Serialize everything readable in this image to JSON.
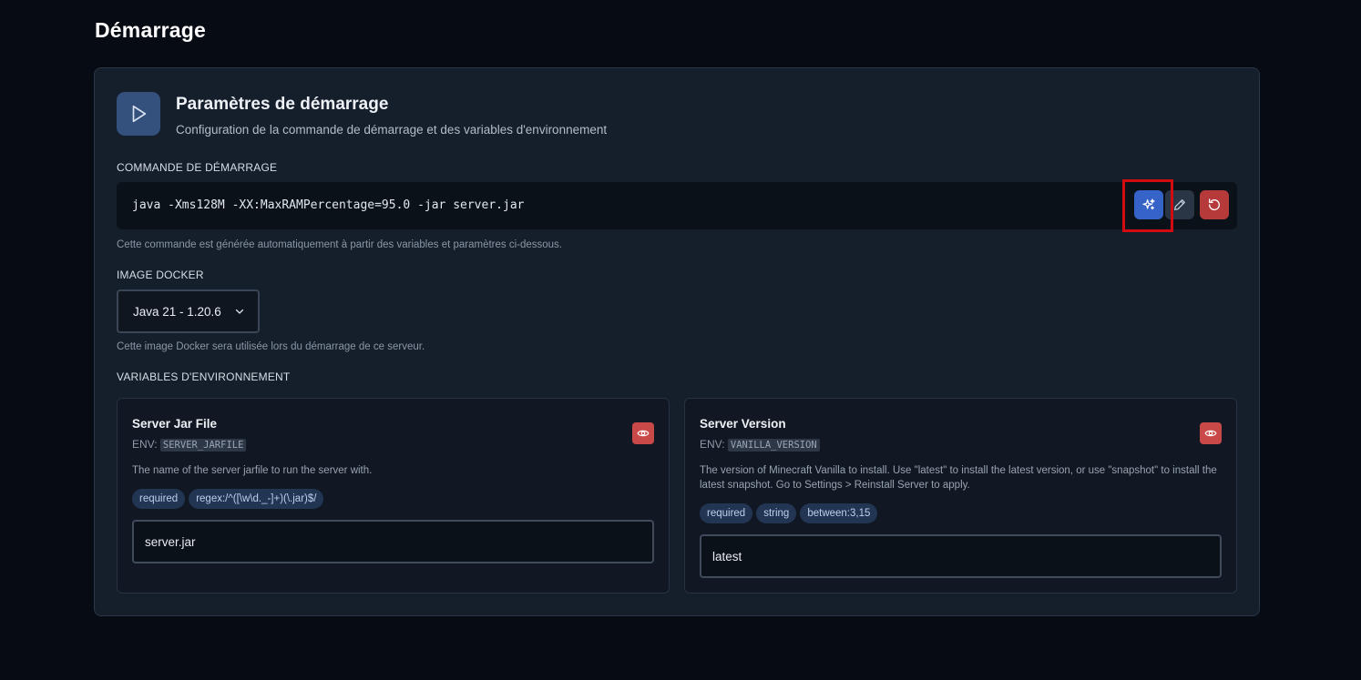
{
  "page": {
    "title": "Démarrage"
  },
  "startup": {
    "title": "Paramètres de démarrage",
    "subtitle": "Configuration de la commande de démarrage et des variables d'environnement",
    "command_label": "COMMANDE DE DÉMARRAGE",
    "command": "java -Xms128M -XX:MaxRAMPercentage=95.0 -jar server.jar",
    "command_help": "Cette commande est générée automatiquement à partir des variables et paramètres ci-dessous.",
    "buttons": {
      "ai_icon": "sparkles-icon",
      "edit_icon": "pencil-icon",
      "reset_icon": "rotate-ccw-icon"
    }
  },
  "docker": {
    "label": "IMAGE DOCKER",
    "selected": "Java 21 - 1.20.6",
    "help": "Cette image Docker sera utilisée lors du démarrage de ce serveur."
  },
  "env": {
    "label": "VARIABLES D'ENVIRONNEMENT",
    "env_prefix": "ENV:",
    "variables": [
      {
        "name": "Server Jar File",
        "env_key": "SERVER_JARFILE",
        "description": "The name of the server jarfile to run the server with.",
        "tags": [
          "required",
          "regex:/^([\\w\\d._-]+)(\\.jar)$/"
        ],
        "value": "server.jar"
      },
      {
        "name": "Server Version",
        "env_key": "VANILLA_VERSION",
        "description": "The version of Minecraft Vanilla to install. Use \"latest\" to install the latest version, or use \"snapshot\" to install the latest snapshot. Go to Settings > Reinstall Server to apply.",
        "tags": [
          "required",
          "string",
          "between:3,15"
        ],
        "value": "latest"
      }
    ]
  },
  "colors": {
    "background": "#070b14",
    "panel": "#151e2b",
    "accent_blue": "#3563c7",
    "danger": "#b63a3a",
    "highlight": "#d10b10"
  }
}
